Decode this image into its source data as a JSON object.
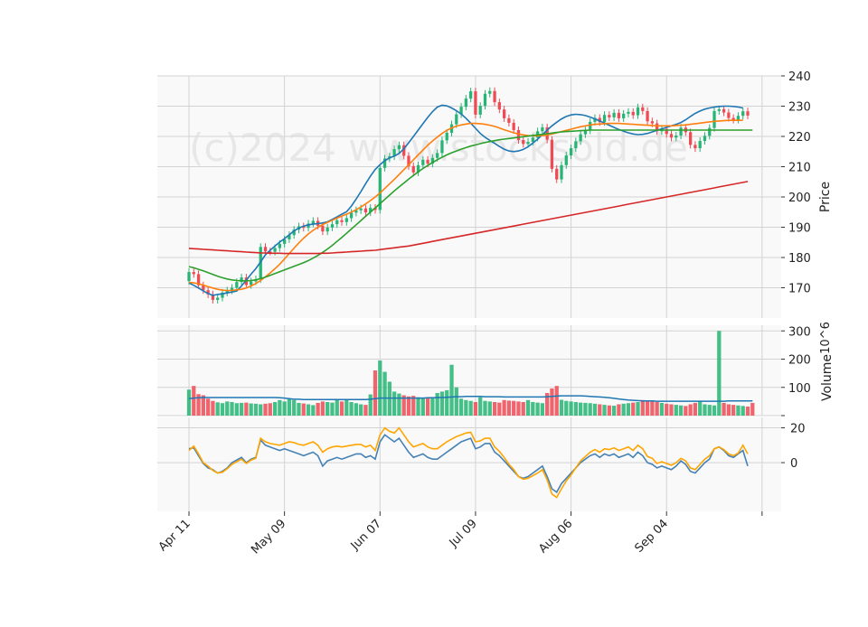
{
  "watermark": "(c)2024 www.stocksold.de",
  "chart_data": [
    {
      "type": "candlestick",
      "panel": "price",
      "ylabel": "Price",
      "ylim": [
        160,
        240
      ],
      "yticks": [
        170,
        180,
        190,
        200,
        210,
        220,
        230,
        240
      ],
      "x_tick_labels": [
        "Apr 11",
        "May 09",
        "Jun 07",
        "Jul 09",
        "Aug 06",
        "Sep 04"
      ],
      "x_tick_index": [
        0,
        20,
        40,
        60,
        80,
        100,
        120
      ],
      "grid": true,
      "colors": {
        "up": "#26b574",
        "down": "#ef4b55"
      },
      "closes": [
        175.2,
        174.5,
        170.8,
        169.2,
        167.8,
        166.0,
        166.7,
        168.4,
        169.1,
        170.0,
        171.9,
        173.4,
        170.9,
        172.1,
        172.8,
        183.5,
        182.0,
        181.9,
        183.1,
        184.5,
        186.0,
        187.4,
        189.2,
        190.3,
        189.8,
        191.2,
        192.1,
        190.5,
        188.6,
        189.9,
        191.0,
        192.3,
        191.7,
        193.0,
        194.8,
        195.6,
        196.2,
        194.9,
        196.4,
        195.7,
        209.6,
        212.7,
        213.4,
        215.8,
        217.1,
        213.6,
        210.2,
        208.1,
        210.5,
        212.3,
        211.0,
        212.9,
        214.5,
        218.7,
        221.2,
        224.0,
        227.3,
        229.8,
        232.5,
        234.9,
        227.2,
        230.1,
        234.1,
        235.0,
        231.3,
        228.9,
        226.0,
        224.5,
        222.1,
        218.8,
        217.5,
        218.2,
        219.6,
        221.7,
        223.0,
        218.9,
        209.3,
        205.8,
        210.5,
        213.7,
        216.1,
        218.4,
        220.7,
        222.0,
        224.8,
        226.1,
        224.7,
        227.1,
        226.3,
        227.8,
        226.0,
        227.5,
        228.1,
        227.0,
        229.6,
        228.4,
        225.0,
        224.3,
        221.7,
        222.5,
        220.8,
        219.6,
        220.3,
        222.9,
        221.4,
        217.2,
        216.1,
        218.5,
        220.2,
        222.8,
        228.4,
        229.0,
        227.9,
        226.1,
        225.5,
        226.8,
        228.3,
        226.9
      ],
      "ma_lines": [
        {
          "color": "#1f77b4",
          "values": [
            171.6,
            170.8,
            169.9,
            169.0,
            168.1,
            167.5,
            167.8,
            168.0,
            168.3,
            168.6,
            168.9,
            170.6,
            172.5,
            174.5,
            176.3,
            178.5,
            180.9,
            182.4,
            183.8,
            185.1,
            186.2,
            187.5,
            188.8,
            189.7,
            190.4,
            190.8,
            191.0,
            191.2,
            191.4,
            191.8,
            192.6,
            193.4,
            194.3,
            195.1,
            197.0,
            199.3,
            201.8,
            204.4,
            206.9,
            209.1,
            210.7,
            212.0,
            212.9,
            213.5,
            214.4,
            215.9,
            217.9,
            220.0,
            222.1,
            224.2,
            226.3,
            228.2,
            229.7,
            230.3,
            230.1,
            229.4,
            228.5,
            227.4,
            226.0,
            224.4,
            222.7,
            221.0,
            219.7,
            218.7,
            217.7,
            216.7,
            215.8,
            215.2,
            215.0,
            215.2,
            215.7,
            216.6,
            217.8,
            219.1,
            220.6,
            222.1,
            223.5,
            224.7,
            225.8,
            226.6,
            227.1,
            227.3,
            227.2,
            226.9,
            226.4,
            225.8,
            225.1,
            224.4,
            223.7,
            223.0,
            222.3,
            221.7,
            221.2,
            220.8,
            220.6,
            220.7,
            221.0,
            221.5,
            222.0,
            222.5,
            223.0,
            223.5,
            224.0,
            224.6,
            225.5,
            226.6,
            227.6,
            228.4,
            229.0,
            229.4,
            229.7,
            229.9,
            230.0,
            230.0,
            229.9,
            229.7,
            229.4
          ]
        },
        {
          "color": "#ff7f0e",
          "values": [
            171.8,
            171.6,
            171.3,
            170.9,
            170.4,
            169.9,
            169.5,
            169.2,
            169.1,
            169.1,
            169.3,
            169.5,
            169.9,
            170.6,
            171.4,
            172.4,
            173.6,
            174.9,
            176.3,
            177.8,
            179.5,
            181.3,
            183.1,
            184.8,
            186.4,
            187.8,
            189.0,
            190.0,
            190.9,
            191.6,
            192.3,
            193.0,
            193.7,
            194.3,
            195.0,
            195.8,
            196.7,
            197.7,
            198.8,
            200.0,
            201.3,
            202.8,
            204.3,
            205.8,
            207.4,
            209.0,
            210.6,
            212.3,
            213.9,
            215.5,
            217.1,
            218.5,
            219.8,
            221.0,
            222.0,
            222.8,
            223.4,
            223.8,
            224.1,
            224.3,
            224.3,
            224.2,
            224.0,
            223.7,
            223.3,
            222.8,
            222.2,
            221.7,
            221.2,
            220.8,
            220.5,
            220.3,
            220.2,
            220.2,
            220.3,
            220.5,
            220.8,
            221.2,
            221.6,
            222.0,
            222.4,
            222.8,
            223.2,
            223.5,
            223.8,
            224.0,
            224.1,
            224.2,
            224.3,
            224.3,
            224.3,
            224.2,
            224.1,
            224.0,
            223.9,
            223.8,
            223.7,
            223.6,
            223.5,
            223.5,
            223.5,
            223.5,
            223.6,
            223.7,
            223.8,
            224.0,
            224.2,
            224.4,
            224.6,
            224.8,
            225.0,
            225.1,
            225.2,
            225.3,
            225.3,
            225.3,
            225.3
          ]
        },
        {
          "color": "#2ca02c",
          "values": [
            177.0,
            176.6,
            176.1,
            175.6,
            175.0,
            174.4,
            173.8,
            173.3,
            172.9,
            172.6,
            172.4,
            172.3,
            172.3,
            172.4,
            172.6,
            173.0,
            173.5,
            174.1,
            174.7,
            175.3,
            175.9,
            176.5,
            177.1,
            177.7,
            178.3,
            179.0,
            179.8,
            180.7,
            181.7,
            182.8,
            184.0,
            185.3,
            186.6,
            188.0,
            189.4,
            190.8,
            192.2,
            193.6,
            195.0,
            196.4,
            197.8,
            199.2,
            200.6,
            202.0,
            203.3,
            204.6,
            205.9,
            207.1,
            208.3,
            209.4,
            210.4,
            211.4,
            212.3,
            213.1,
            213.9,
            214.6,
            215.2,
            215.8,
            216.3,
            216.8,
            217.2,
            217.6,
            218.0,
            218.3,
            218.6,
            218.9,
            219.1,
            219.3,
            219.5,
            219.7,
            219.9,
            220.1,
            220.3,
            220.5,
            220.7,
            220.9,
            221.1,
            221.3,
            221.5,
            221.6,
            221.7,
            221.8,
            221.9,
            222.0,
            222.1,
            222.1,
            222.1,
            222.1,
            222.1,
            222.1,
            222.1,
            222.1,
            222.1,
            222.1,
            222.1,
            222.1,
            222.1,
            222.1,
            222.1,
            222.1,
            222.1,
            222.1,
            222.1,
            222.1,
            222.1,
            222.1,
            222.1,
            222.1,
            222.1,
            222.1,
            222.1,
            222.1,
            222.1,
            222.1,
            222.1,
            222.1,
            222.1,
            222.1,
            222.1
          ]
        },
        {
          "color": "#d62728",
          "values": [
            183.0,
            182.9,
            182.8,
            182.7,
            182.6,
            182.5,
            182.4,
            182.3,
            182.2,
            182.1,
            182.0,
            181.9,
            181.8,
            181.7,
            181.6,
            181.5,
            181.5,
            181.4,
            181.4,
            181.4,
            181.3,
            181.3,
            181.3,
            181.3,
            181.3,
            181.3,
            181.3,
            181.3,
            181.4,
            181.4,
            181.5,
            181.6,
            181.7,
            181.8,
            181.9,
            182.0,
            182.1,
            182.2,
            182.3,
            182.4,
            182.6,
            182.8,
            183.0,
            183.2,
            183.4,
            183.6,
            183.8,
            184.1,
            184.4,
            184.7,
            185.0,
            185.3,
            185.6,
            185.9,
            186.2,
            186.5,
            186.8,
            187.1,
            187.4,
            187.7,
            188.0,
            188.3,
            188.6,
            188.9,
            189.2,
            189.5,
            189.8,
            190.1,
            190.4,
            190.7,
            191.0,
            191.3,
            191.6,
            191.9,
            192.2,
            192.5,
            192.8,
            193.1,
            193.4,
            193.7,
            194.0,
            194.3,
            194.6,
            194.9,
            195.2,
            195.5,
            195.8,
            196.1,
            196.4,
            196.7,
            197.0,
            197.3,
            197.6,
            197.9,
            198.2,
            198.5,
            198.8,
            199.1,
            199.4,
            199.7,
            200.0,
            200.3,
            200.6,
            200.9,
            201.2,
            201.5,
            201.8,
            202.1,
            202.4,
            202.7,
            203.0,
            203.3,
            203.6,
            203.9,
            204.2,
            204.5,
            204.8,
            205.1
          ]
        }
      ]
    },
    {
      "type": "bar",
      "panel": "volume",
      "ylabel": "Volume",
      "unit_label": "10^6",
      "ylim": [
        0,
        320
      ],
      "yticks": [
        0,
        100,
        200,
        300
      ],
      "values": [
        92,
        105,
        76,
        72,
        60,
        52,
        47,
        44,
        50,
        48,
        44,
        45,
        46,
        43,
        42,
        40,
        42,
        44,
        48,
        55,
        50,
        58,
        55,
        45,
        43,
        40,
        37,
        45,
        50,
        48,
        46,
        55,
        50,
        58,
        48,
        44,
        40,
        38,
        75,
        160,
        195,
        155,
        120,
        85,
        78,
        72,
        68,
        70,
        65,
        63,
        62,
        65,
        80,
        85,
        90,
        180,
        100,
        60,
        55,
        52,
        48,
        65,
        52,
        50,
        48,
        46,
        55,
        53,
        52,
        50,
        48,
        55,
        48,
        46,
        44,
        80,
        96,
        105,
        56,
        52,
        50,
        48,
        46,
        45,
        44,
        42,
        40,
        38,
        36,
        35,
        40,
        42,
        44,
        46,
        48,
        55,
        50,
        52,
        48,
        45,
        42,
        40,
        38,
        36,
        34,
        40,
        45,
        50,
        40,
        38,
        36,
        300,
        45,
        40,
        38,
        36,
        34,
        32,
        45
      ],
      "avg_values": [
        60,
        62,
        63,
        64,
        64,
        64,
        64,
        64,
        64,
        64,
        64,
        64,
        64,
        64,
        64,
        64,
        64,
        64,
        64,
        63,
        62,
        60,
        58,
        58,
        57,
        57,
        57,
        57,
        57,
        57,
        57,
        57,
        57,
        57,
        57,
        57,
        57,
        57,
        58,
        60,
        62,
        62,
        62,
        62,
        62,
        62,
        62,
        62,
        62,
        62,
        63,
        63,
        64,
        64,
        65,
        66,
        67,
        67,
        68,
        68,
        68,
        68,
        67,
        67,
        67,
        67,
        66,
        66,
        66,
        66,
        66,
        66,
        66,
        66,
        66,
        67,
        68,
        69,
        70,
        70,
        70,
        70,
        70,
        69,
        68,
        67,
        66,
        65,
        63,
        61,
        59,
        57,
        55,
        54,
        53,
        52,
        52,
        52,
        51,
        51,
        51,
        51,
        51,
        51,
        51,
        51,
        51,
        51,
        51,
        51,
        51,
        51,
        51,
        52,
        52,
        52,
        52,
        52,
        52
      ]
    },
    {
      "type": "line",
      "panel": "oscillator",
      "ylim": [
        -28,
        26
      ],
      "yticks": [
        0,
        20
      ],
      "series": [
        {
          "color": "#4682b4",
          "values": [
            8.0,
            8.5,
            4.0,
            -0.5,
            -3.0,
            -4.0,
            -6.0,
            -5.0,
            -3.0,
            0.0,
            1.5,
            3.0,
            0.0,
            2.0,
            3.0,
            13.0,
            10.0,
            9.0,
            8.0,
            7.0,
            8.0,
            7.0,
            6.0,
            5.0,
            4.0,
            5.0,
            6.0,
            4.0,
            -2.0,
            1.0,
            2.0,
            3.0,
            2.0,
            3.0,
            4.0,
            5.0,
            5.0,
            3.0,
            4.0,
            2.0,
            12.0,
            16.0,
            14.0,
            12.0,
            14.0,
            10.0,
            6.0,
            3.0,
            4.0,
            5.0,
            3.0,
            2.0,
            2.0,
            4.0,
            6.0,
            8.0,
            10.0,
            12.0,
            13.0,
            14.0,
            8.0,
            9.0,
            11.0,
            11.0,
            6.0,
            4.0,
            1.0,
            -2.0,
            -5.0,
            -8.0,
            -9.0,
            -8.0,
            -6.0,
            -4.0,
            -2.0,
            -8.0,
            -15.0,
            -17.0,
            -12.0,
            -9.0,
            -6.0,
            -3.0,
            0.0,
            2.0,
            4.0,
            5.0,
            3.0,
            5.0,
            4.0,
            5.0,
            3.0,
            4.0,
            5.0,
            3.0,
            6.0,
            4.0,
            0.0,
            -1.0,
            -3.0,
            -2.0,
            -3.0,
            -4.0,
            -2.0,
            1.0,
            -1.0,
            -5.0,
            -6.0,
            -3.0,
            0.0,
            2.0,
            8.0,
            9.0,
            7.0,
            4.0,
            3.0,
            5.0,
            7.0,
            -2.0
          ]
        },
        {
          "color": "#ffa500",
          "values": [
            7.0,
            9.5,
            5.0,
            0.0,
            -2.0,
            -4.5,
            -6.0,
            -5.5,
            -3.5,
            -1.0,
            0.5,
            2.0,
            -0.5,
            1.5,
            2.5,
            14.0,
            12.0,
            11.0,
            10.5,
            10.0,
            11.0,
            12.0,
            11.5,
            10.5,
            10.0,
            11.0,
            12.0,
            10.0,
            6.0,
            8.0,
            9.0,
            9.5,
            9.0,
            9.5,
            10.0,
            10.5,
            10.5,
            9.0,
            10.0,
            7.0,
            16.0,
            20.0,
            18.0,
            17.0,
            20.0,
            16.0,
            12.0,
            9.0,
            10.0,
            11.0,
            9.0,
            8.0,
            8.0,
            10.0,
            12.0,
            13.5,
            15.0,
            16.0,
            17.0,
            17.5,
            12.0,
            12.5,
            14.0,
            14.0,
            9.0,
            6.5,
            3.0,
            -1.0,
            -4.0,
            -8.0,
            -9.5,
            -9.0,
            -7.5,
            -6.0,
            -4.0,
            -10.0,
            -18.0,
            -20.0,
            -15.0,
            -10.5,
            -7.0,
            -3.0,
            1.0,
            3.5,
            6.0,
            7.5,
            6.0,
            8.0,
            7.5,
            8.5,
            7.0,
            8.0,
            9.0,
            7.0,
            10.0,
            8.0,
            3.5,
            2.5,
            -0.5,
            0.5,
            -0.5,
            -1.5,
            0.0,
            2.5,
            1.0,
            -3.0,
            -4.0,
            -1.0,
            2.0,
            4.0,
            8.0,
            9.0,
            7.5,
            5.0,
            4.0,
            5.5,
            10.0,
            5.0
          ]
        }
      ]
    }
  ]
}
